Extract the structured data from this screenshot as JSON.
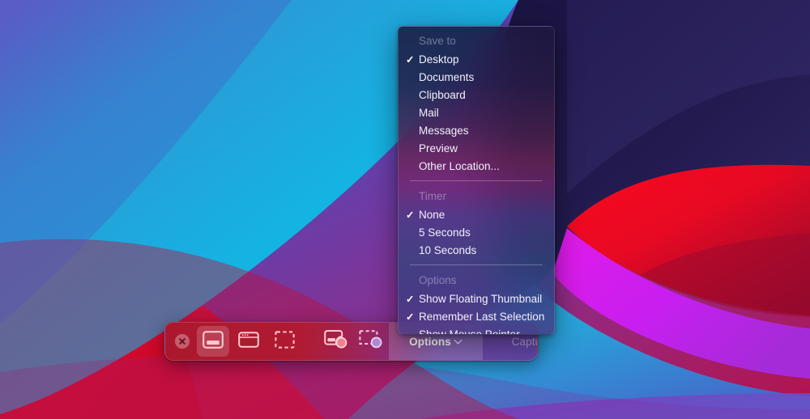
{
  "desktop": {
    "wallpaper_name": "big-sur-waves",
    "colors": {
      "band_navy": "#211a4a",
      "band_navy_light": "#2e2560",
      "band_red": "#ec0a20",
      "band_magenta": "#d61af0",
      "band_cyan": "#19b8e0",
      "band_blue": "#3560c8",
      "band_purple": "#7a46b8",
      "band_crimson": "#c40b3a"
    }
  },
  "toolbar": {
    "name": "Screenshot Toolbar",
    "close_label": "Close",
    "capture_buttons": [
      {
        "id": "capture-entire-screen",
        "label": "Capture Entire Screen",
        "icon": "screen-icon",
        "selected": true
      },
      {
        "id": "capture-selected-window",
        "label": "Capture Selected Window",
        "icon": "window-icon",
        "selected": false
      },
      {
        "id": "capture-selected-portion",
        "label": "Capture Selected Portion",
        "icon": "selection-icon",
        "selected": false
      }
    ],
    "record_buttons": [
      {
        "id": "record-entire-screen",
        "label": "Record Entire Screen",
        "icon": "screen-record-icon",
        "selected": false
      },
      {
        "id": "record-selected-portion",
        "label": "Record Selected Portion",
        "icon": "selection-record-icon",
        "selected": false
      }
    ],
    "options_label": "Options",
    "options_active": true,
    "capture_label": "Capture",
    "capture_enabled": false
  },
  "menu": {
    "sections": [
      {
        "header": "Save to",
        "items": [
          {
            "label": "Desktop",
            "checked": true
          },
          {
            "label": "Documents",
            "checked": false
          },
          {
            "label": "Clipboard",
            "checked": false
          },
          {
            "label": "Mail",
            "checked": false
          },
          {
            "label": "Messages",
            "checked": false
          },
          {
            "label": "Preview",
            "checked": false
          },
          {
            "label": "Other Location...",
            "checked": false
          }
        ]
      },
      {
        "header": "Timer",
        "items": [
          {
            "label": "None",
            "checked": true
          },
          {
            "label": "5 Seconds",
            "checked": false
          },
          {
            "label": "10 Seconds",
            "checked": false
          }
        ]
      },
      {
        "header": "Options",
        "items": [
          {
            "label": "Show Floating Thumbnail",
            "checked": true
          },
          {
            "label": "Remember Last Selection",
            "checked": true
          },
          {
            "label": "Show Mouse Pointer",
            "checked": false
          }
        ]
      }
    ],
    "check_glyph": "✓"
  }
}
